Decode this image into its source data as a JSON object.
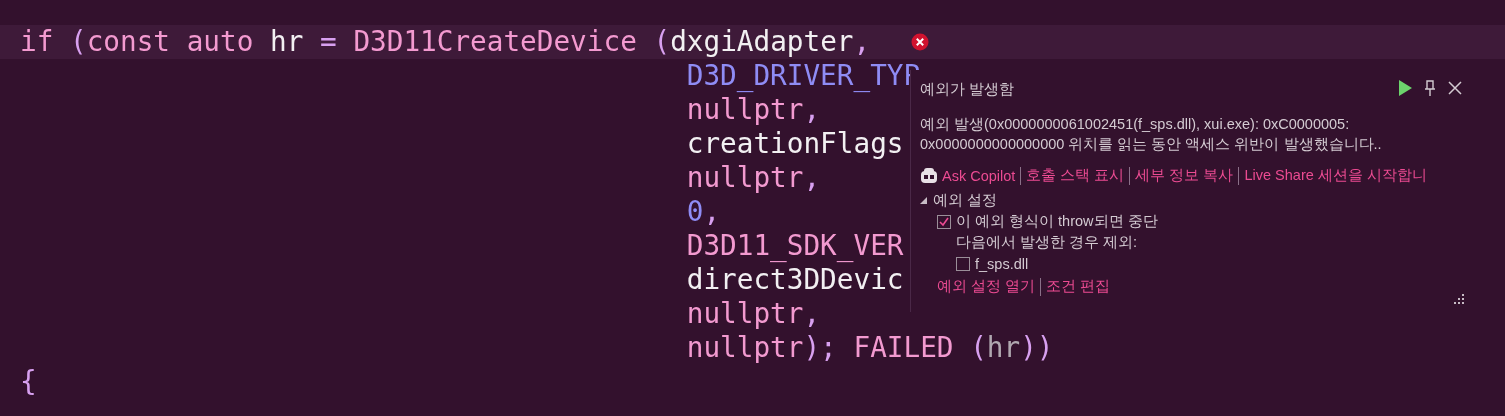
{
  "code_lines": [
    {
      "kind": "statement",
      "current": true,
      "error_marker": true,
      "tokens": [
        {
          "text": "if ",
          "kind": "keyword"
        },
        {
          "text": "(",
          "kind": "punct"
        },
        {
          "text": "const auto ",
          "kind": "keyword"
        },
        {
          "text": "hr ",
          "kind": "variable"
        },
        {
          "text": "= ",
          "kind": "punct"
        },
        {
          "text": "D3D11CreateDevice ",
          "kind": "function"
        },
        {
          "text": "(",
          "kind": "punct"
        },
        {
          "text": "dxgiAdapter",
          "kind": "variable"
        },
        {
          "text": ",",
          "kind": "punct"
        }
      ]
    },
    {
      "kind": "continuation",
      "current": false,
      "error_marker": false,
      "tokens": [
        {
          "text": "D3D_DRIVER_TYP",
          "kind": "constant"
        }
      ]
    },
    {
      "kind": "continuation",
      "current": false,
      "error_marker": false,
      "tokens": [
        {
          "text": "nullptr",
          "kind": "keyword"
        },
        {
          "text": ",",
          "kind": "punct"
        }
      ]
    },
    {
      "kind": "continuation",
      "current": false,
      "error_marker": false,
      "tokens": [
        {
          "text": "creationFlags",
          "kind": "variable"
        }
      ]
    },
    {
      "kind": "continuation",
      "current": false,
      "error_marker": false,
      "tokens": [
        {
          "text": "nullptr",
          "kind": "keyword"
        },
        {
          "text": ",",
          "kind": "punct"
        }
      ]
    },
    {
      "kind": "continuation",
      "current": false,
      "error_marker": false,
      "tokens": [
        {
          "text": "0",
          "kind": "constant"
        },
        {
          "text": ",",
          "kind": "punct"
        }
      ]
    },
    {
      "kind": "continuation",
      "current": false,
      "error_marker": false,
      "tokens": [
        {
          "text": "D3D11_SDK_VER",
          "kind": "function"
        }
      ]
    },
    {
      "kind": "continuation",
      "current": false,
      "error_marker": false,
      "tokens": [
        {
          "text": "direct3DDevic",
          "kind": "variable"
        }
      ]
    },
    {
      "kind": "continuation",
      "current": false,
      "error_marker": false,
      "tokens": [
        {
          "text": "nullptr",
          "kind": "keyword"
        },
        {
          "text": ",",
          "kind": "punct"
        }
      ]
    },
    {
      "kind": "continuation",
      "current": false,
      "error_marker": false,
      "tokens": [
        {
          "text": "nullptr",
          "kind": "keyword"
        },
        {
          "text": "); ",
          "kind": "punct"
        },
        {
          "text": "FAILED ",
          "kind": "function"
        },
        {
          "text": "(",
          "kind": "punct"
        },
        {
          "text": "hr",
          "kind": "dim"
        },
        {
          "text": "))",
          "kind": "punct"
        }
      ]
    },
    {
      "kind": "brace",
      "current": false,
      "error_marker": false,
      "tokens": [
        {
          "text": "{",
          "kind": "punct"
        }
      ]
    }
  ],
  "exception_popup": {
    "title": "예외가 발생함",
    "message": [
      "예외 발생(0x0000000061002451(f_sps.dll), xui.exe): 0xC0000005:",
      "0x0000000000000000 위치를 읽는 동안 액세스 위반이 발생했습니다.."
    ],
    "actions": [
      {
        "label": "Ask Copilot",
        "kind": "copilot"
      },
      {
        "label": "호출 스택 표시",
        "kind": "link"
      },
      {
        "label": "세부 정보 복사",
        "kind": "link"
      },
      {
        "label": "Live Share 세션을 시작합니",
        "kind": "link"
      }
    ],
    "settings": {
      "label": "예외 설정",
      "expanded": true,
      "options": [
        {
          "kind": "checkbox",
          "label": "이 예외 형식이 throw되면 중단",
          "checked": true
        },
        {
          "kind": "note",
          "label": "다음에서 발생한 경우 제외:",
          "children": [
            {
              "kind": "checkbox",
              "label": "f_sps.dll",
              "checked": false
            }
          ]
        }
      ]
    },
    "footer_links": [
      {
        "label": "예외 설정 열기"
      },
      {
        "label": "조건 편집"
      }
    ]
  }
}
